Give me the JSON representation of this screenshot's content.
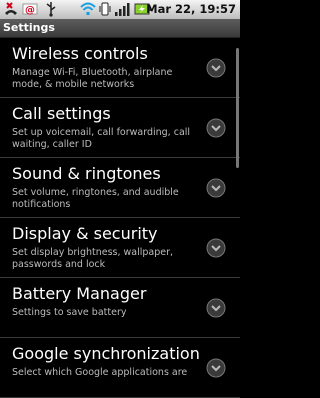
{
  "status": {
    "date_time": "Mar 22, 19:57",
    "icons": [
      "missed-call-icon",
      "gmail-icon",
      "usb-icon",
      "wifi-icon",
      "vibrate-icon",
      "signal-icon",
      "battery-charging-icon"
    ]
  },
  "header": {
    "title": "Settings"
  },
  "settings": [
    {
      "title": "Wireless controls",
      "subtitle": "Manage Wi-Fi, Bluetooth, airplane mode, & mobile networks"
    },
    {
      "title": "Call settings",
      "subtitle": "Set up voicemail, call forwarding, call waiting, caller ID"
    },
    {
      "title": "Sound & ringtones",
      "subtitle": "Set volume, ringtones, and audible notifications"
    },
    {
      "title": "Display & security",
      "subtitle": "Set display brightness, wallpaper, passwords and lock"
    },
    {
      "title": "Battery Manager",
      "subtitle": "Settings to save battery"
    },
    {
      "title": "Google synchronization",
      "subtitle": "Select which Google applications are"
    }
  ]
}
